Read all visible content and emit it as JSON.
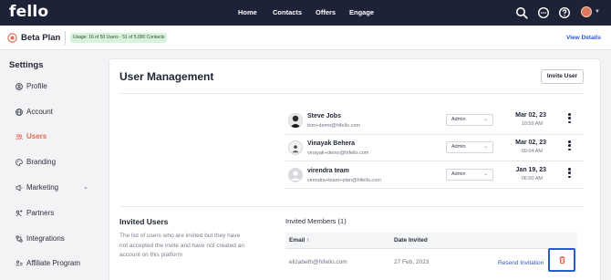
{
  "brand": {
    "logo_text": "fello"
  },
  "topnav": {
    "links": [
      "Home",
      "Contacts",
      "Offers",
      "Engage"
    ],
    "icons": [
      "search-icon",
      "message-icon",
      "help-icon",
      "user-avatar"
    ]
  },
  "planbar": {
    "plan_name": "Beta Plan",
    "usage": "Usage: 16 of 50 Users · 51 of 5,000 Contacts",
    "view_details": "View Details"
  },
  "sidebar": {
    "title": "Settings",
    "items": [
      {
        "label": "Profile",
        "icon": "profile-icon"
      },
      {
        "label": "Account",
        "icon": "globe-icon"
      },
      {
        "label": "Users",
        "icon": "users-icon",
        "active": true
      },
      {
        "label": "Branding",
        "icon": "palette-icon"
      },
      {
        "label": "Marketing",
        "icon": "marketing-icon",
        "expandable": true
      },
      {
        "label": "Partners",
        "icon": "partners-icon"
      },
      {
        "label": "Integrations",
        "icon": "integrations-icon"
      },
      {
        "label": "Affiliate Program",
        "icon": "affiliate-icon"
      }
    ]
  },
  "main": {
    "title": "User Management",
    "invite_button": "Invite User",
    "users": [
      {
        "name": "Steve Jobs",
        "email": "tom+demo@hifello.com",
        "role": "Admin",
        "date": "Mar 02, 23",
        "time": "10:59 AM"
      },
      {
        "name": "Vinayak Behera",
        "email": "vinayak+demo@hifello.com",
        "role": "Admin",
        "date": "Mar 02, 23",
        "time": "09:04 AM"
      },
      {
        "name": "virendra team",
        "email": "virendra+team+plan@hifello.com",
        "role": "Admin",
        "date": "Jan 19, 23",
        "time": "06:00 AM"
      }
    ],
    "invited": {
      "title": "Invited Users",
      "description": "The list of users who are invited but they have not accepted the invite and have not created an account on this platform",
      "members_title": "Invited Members (1)",
      "columns": {
        "email": "Email ↑",
        "date": "Date Invited"
      },
      "rows": [
        {
          "email": "elizabeth@hifello.com",
          "date": "27 Feb, 2023",
          "action": "Resend Invitation"
        }
      ]
    }
  },
  "colors": {
    "nav_bg": "#1d2236",
    "accent": "#e06a54",
    "link": "#2e57c9",
    "badge_bg": "#d9f2dc"
  }
}
